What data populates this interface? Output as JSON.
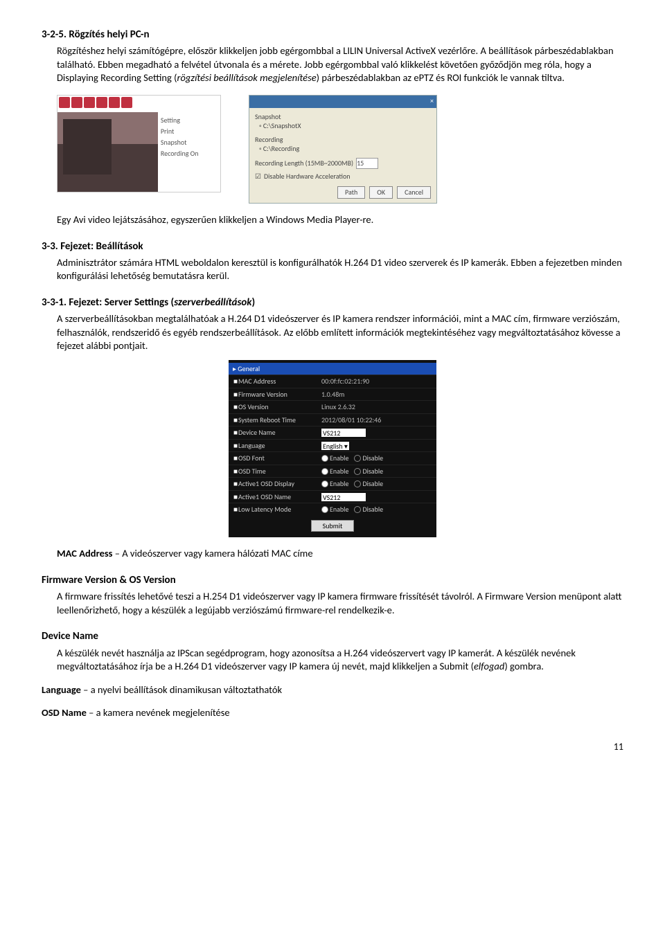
{
  "s325": {
    "heading": "3-2-5. Rögzítés helyi PC-n",
    "p1": "Rögzítéshez helyi számítógépre, először klikkeljen jobb egérgombbal a LILIN Universal ActiveX vezérlőre. A beállítások párbeszédablakban található. Ebben megadható a felvétel útvonala és a mérete. Jobb egérgombbal való klikkelést követően győződjön meg róla, hogy a Displaying Recording Setting (",
    "p1_ital": "rögzítési beállítások megjelenítése",
    "p1_tail": ") párbeszédablakban az ePTZ és ROI funkciók le vannak tiltva."
  },
  "fig1": {
    "menu": [
      "Setting",
      "Print",
      "Snapshot",
      "Recording On"
    ],
    "dialog": {
      "group1": "Snapshot",
      "r1": "C:\\SnapshotX",
      "group2": "Recording",
      "r2": "C:\\Recording",
      "lenLabel": "Recording Length (15MB~2000MB)",
      "lenVal": "15",
      "chk": "Disable Hardware Acceleration",
      "btnPath": "Path",
      "btnOk": "OK",
      "btnCancel": "Cancel"
    }
  },
  "aviLine": "Egy Avi video lejátszásához, egyszerűen klikkeljen a Windows Media Player-re.",
  "s33": {
    "heading": "3-3. Fejezet: Beállítások",
    "p1": "Adminisztrátor számára HTML weboldalon keresztül is konfigurálhatók H.264 D1 video szerverek és IP kamerák. Ebben a fejezetben minden konfigurálási lehetőség bemutatásra kerül."
  },
  "s331": {
    "heading_a": "3-3-1. Fejezet: Server Settings (",
    "heading_ital": "szerverbeállítások",
    "heading_b": ")",
    "p1": "A szerverbeállításokban megtalálhatóak a H.264 D1 videószerver és IP kamera rendszer információi, mint a MAC cím, firmware verziószám, felhasználók, rendszeridő és egyéb rendszerbeállítások. Az előbb említett információk megtekintéséhez vagy megváltoztatásához kövesse a fejezet alábbi pontjait."
  },
  "panel": {
    "title": "General",
    "rows": [
      {
        "label": "MAC Address",
        "val": "00:0f:fc:02:21:90"
      },
      {
        "label": "Firmware Version",
        "val": "1.0.48m"
      },
      {
        "label": "OS Version",
        "val": "Linux 2.6.32"
      },
      {
        "label": "System Reboot Time",
        "val": "2012/08/01 10:22:46"
      },
      {
        "label": "Device Name",
        "type": "input",
        "val": "VS212"
      },
      {
        "label": "Language",
        "type": "select",
        "val": "English"
      },
      {
        "label": "OSD Font",
        "type": "radio",
        "on": "Enable",
        "off": "Disable"
      },
      {
        "label": "OSD Time",
        "type": "radio",
        "on": "Enable",
        "off": "Disable"
      },
      {
        "label": "Active1 OSD Display",
        "type": "radio",
        "on": "Enable",
        "off": "Disable"
      },
      {
        "label": "Active1 OSD Name",
        "type": "input",
        "val": "VS212"
      },
      {
        "label": "Low Latency Mode",
        "type": "radio",
        "on": "Enable",
        "off": "Disable"
      }
    ],
    "submit": "Submit"
  },
  "mac": {
    "label": "MAC Address",
    "sep": " – ",
    "text": "A videószerver vagy kamera hálózati MAC címe"
  },
  "fw": {
    "heading": "Firmware Version & OS Version",
    "p1": "A firmware frissítés lehetővé teszi a H.254 D1 videószerver vagy IP kamera firmware frissítését távolról. A Firmware Version menüpont alatt leellenőrizhető, hogy a készülék a legújabb verziószámú firmware-rel rendelkezik-e."
  },
  "dev": {
    "heading": "Device Name",
    "p1_a": "A készülék nevét használja az IPScan segédprogram, hogy azonosítsa a H.264 videószervert vagy IP kamerát. A készülék nevének megváltoztatásához írja be a H.264 D1 videószerver vagy IP kamera új nevét, majd klikkeljen a Submit (",
    "p1_ital": "elfogad",
    "p1_b": ") gombra."
  },
  "lang": {
    "label": "Language",
    "sep": " – ",
    "text": "a nyelvi beállítások dinamikusan változtathatók"
  },
  "osd": {
    "label": "OSD Name",
    "sep": " – ",
    "text": "a kamera nevének megjelenítése"
  },
  "pageNumber": "11"
}
